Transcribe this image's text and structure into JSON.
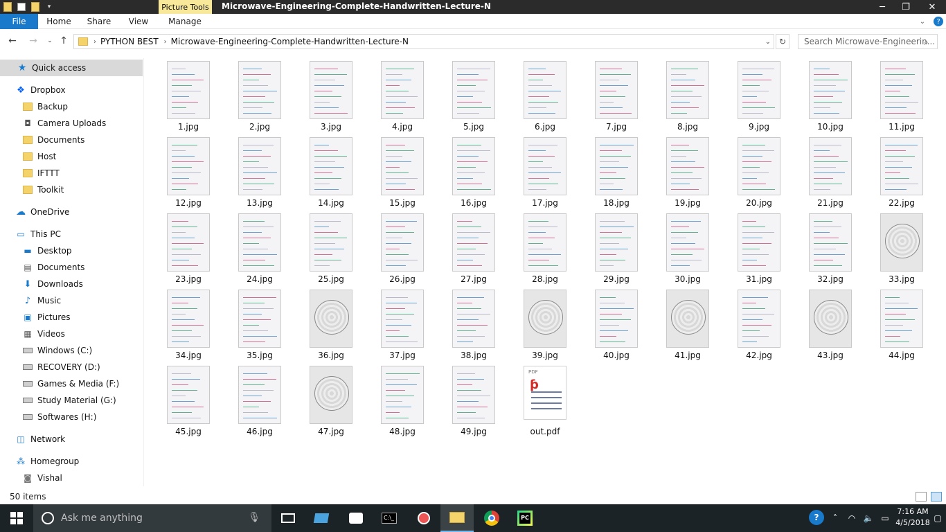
{
  "window": {
    "title": "Microwave-Engineering-Complete-Handwritten-Lecture-N",
    "context_tab_label": "Picture Tools",
    "minimize_glyph": "─",
    "maximize_glyph": "❐",
    "close_glyph": "✕"
  },
  "ribbon": {
    "tabs": [
      {
        "label": "File"
      },
      {
        "label": "Home"
      },
      {
        "label": "Share"
      },
      {
        "label": "View"
      },
      {
        "label": "Manage"
      }
    ]
  },
  "address": {
    "breadcrumb": [
      "PYTHON BEST",
      "Microwave-Engineering-Complete-Handwritten-Lecture-N"
    ],
    "search_placeholder": "Search Microwave-Engineerin..."
  },
  "sidebar": {
    "items": [
      {
        "label": "Quick access",
        "icon": "star-icon",
        "selected": true
      },
      {
        "label": "Dropbox",
        "icon": "dropbox-icon"
      },
      {
        "label": "Backup",
        "icon": "folder-icon"
      },
      {
        "label": "Camera Uploads",
        "icon": "camera-icon"
      },
      {
        "label": "Documents",
        "icon": "folder-icon"
      },
      {
        "label": "Host",
        "icon": "folder-icon"
      },
      {
        "label": "IFTTT",
        "icon": "folder-icon"
      },
      {
        "label": "Toolkit",
        "icon": "folder-icon"
      },
      {
        "label": "OneDrive",
        "icon": "cloud-icon"
      },
      {
        "label": "This PC",
        "icon": "computer-icon"
      },
      {
        "label": "Desktop",
        "icon": "desktop-icon"
      },
      {
        "label": "Documents",
        "icon": "document-icon"
      },
      {
        "label": "Downloads",
        "icon": "download-icon"
      },
      {
        "label": "Music",
        "icon": "music-icon"
      },
      {
        "label": "Pictures",
        "icon": "pictures-icon"
      },
      {
        "label": "Videos",
        "icon": "videos-icon"
      },
      {
        "label": "Windows (C:)",
        "icon": "drive-icon"
      },
      {
        "label": "RECOVERY (D:)",
        "icon": "drive-icon"
      },
      {
        "label": "Games & Media (F:)",
        "icon": "drive-icon"
      },
      {
        "label": "Study Material (G:)",
        "icon": "drive-icon"
      },
      {
        "label": "Softwares (H:)",
        "icon": "drive-icon"
      },
      {
        "label": "Network",
        "icon": "network-icon"
      },
      {
        "label": "Homegroup",
        "icon": "homegroup-icon"
      },
      {
        "label": "Vishal",
        "icon": "user-icon"
      }
    ]
  },
  "files": [
    {
      "name": "1.jpg"
    },
    {
      "name": "2.jpg"
    },
    {
      "name": "3.jpg"
    },
    {
      "name": "4.jpg"
    },
    {
      "name": "5.jpg"
    },
    {
      "name": "6.jpg"
    },
    {
      "name": "7.jpg"
    },
    {
      "name": "8.jpg"
    },
    {
      "name": "9.jpg"
    },
    {
      "name": "10.jpg"
    },
    {
      "name": "11.jpg"
    },
    {
      "name": "12.jpg"
    },
    {
      "name": "13.jpg"
    },
    {
      "name": "14.jpg"
    },
    {
      "name": "15.jpg"
    },
    {
      "name": "16.jpg"
    },
    {
      "name": "17.jpg"
    },
    {
      "name": "18.jpg"
    },
    {
      "name": "19.jpg"
    },
    {
      "name": "20.jpg"
    },
    {
      "name": "21.jpg"
    },
    {
      "name": "22.jpg"
    },
    {
      "name": "23.jpg"
    },
    {
      "name": "24.jpg"
    },
    {
      "name": "25.jpg"
    },
    {
      "name": "26.jpg"
    },
    {
      "name": "27.jpg"
    },
    {
      "name": "28.jpg"
    },
    {
      "name": "29.jpg"
    },
    {
      "name": "30.jpg"
    },
    {
      "name": "31.jpg"
    },
    {
      "name": "32.jpg"
    },
    {
      "name": "33.jpg",
      "kind": "smith"
    },
    {
      "name": "34.jpg"
    },
    {
      "name": "35.jpg"
    },
    {
      "name": "36.jpg",
      "kind": "smith"
    },
    {
      "name": "37.jpg"
    },
    {
      "name": "38.jpg"
    },
    {
      "name": "39.jpg",
      "kind": "smith"
    },
    {
      "name": "40.jpg"
    },
    {
      "name": "41.jpg",
      "kind": "smith"
    },
    {
      "name": "42.jpg"
    },
    {
      "name": "43.jpg",
      "kind": "smith"
    },
    {
      "name": "44.jpg"
    },
    {
      "name": "45.jpg"
    },
    {
      "name": "46.jpg"
    },
    {
      "name": "47.jpg",
      "kind": "smith"
    },
    {
      "name": "48.jpg"
    },
    {
      "name": "49.jpg"
    },
    {
      "name": "out.pdf",
      "kind": "pdf"
    }
  ],
  "pdf_badge": "PDF",
  "status": {
    "item_count": "50 items"
  },
  "taskbar": {
    "search_placeholder": "Ask me anything",
    "clock_time": "7:16 AM",
    "clock_date": "4/5/2018"
  },
  "colors": {
    "accent": "#1979ca",
    "taskbar": "#1c2326",
    "titlebar": "#2b2b2b",
    "context_tab": "#f8e89a"
  }
}
